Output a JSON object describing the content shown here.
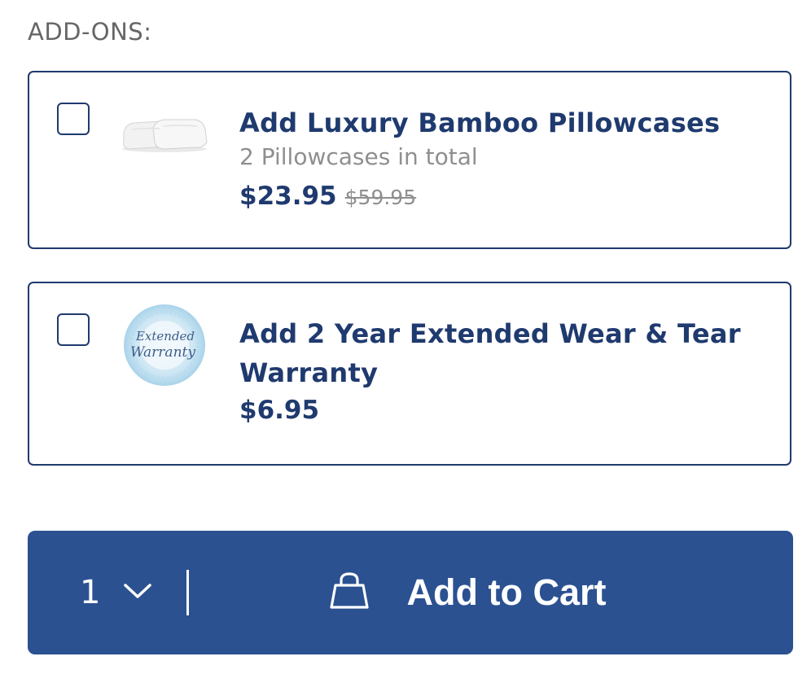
{
  "addons": {
    "heading": "ADD-ONS:",
    "items": [
      {
        "title": "Add Luxury Bamboo Pillowcases",
        "subtitle": "2 Pillowcases in total",
        "price": "$23.95",
        "original_price": "$59.95",
        "checked": false,
        "icon": "pillowcases-image"
      },
      {
        "title": "Add 2 Year Extended Wear & Tear Warranty",
        "price": "$6.95",
        "checked": false,
        "icon": "extended-warranty-badge",
        "badge_text": [
          "Extended",
          "Warranty"
        ]
      }
    ]
  },
  "cart": {
    "quantity": "1",
    "button_label": "Add to Cart",
    "icon": "shopping-bag-icon"
  },
  "colors": {
    "brand_navy": "#1f3a6e",
    "button_blue": "#2b5191",
    "muted_gray": "#8f8f8f",
    "badge_blue": "#a9d3ea"
  }
}
